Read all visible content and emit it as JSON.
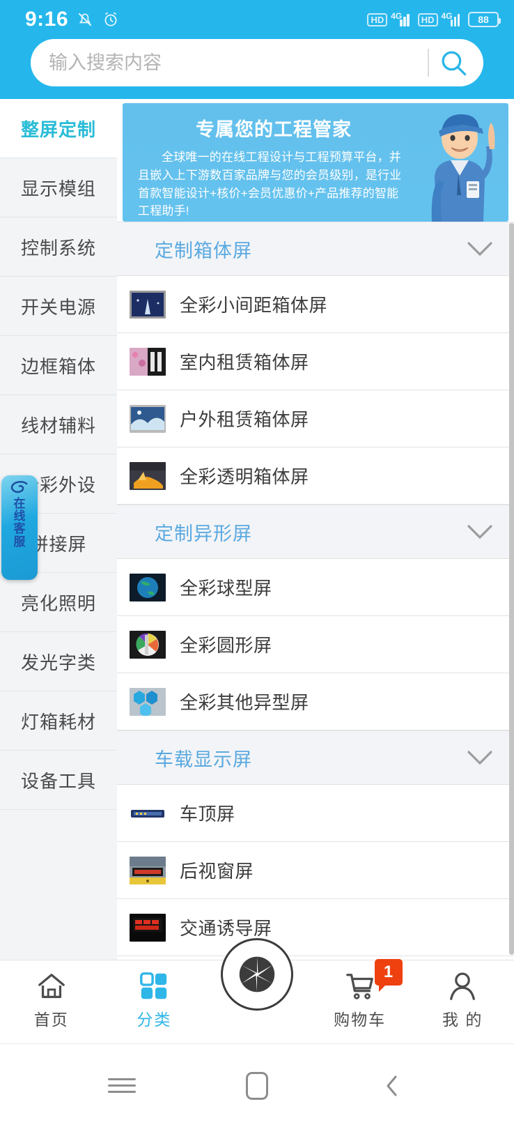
{
  "status_bar": {
    "time": "9:16",
    "mute_icon": "bell-muted-icon",
    "alarm_icon": "alarm-clock-icon",
    "sim1_hd": "HD",
    "sim1_network": "4G",
    "sim2_hd": "HD",
    "sim2_network": "4G",
    "battery_percent": "88"
  },
  "search": {
    "placeholder": "输入搜索内容",
    "value": "",
    "icon": "search-icon"
  },
  "sidebar": {
    "items": [
      {
        "label": "整屏定制",
        "active": true
      },
      {
        "label": "显示模组",
        "active": false
      },
      {
        "label": "控制系统",
        "active": false
      },
      {
        "label": "开关电源",
        "active": false
      },
      {
        "label": "边框箱体",
        "active": false
      },
      {
        "label": "线材辅料",
        "active": false
      },
      {
        "label": "全彩外设",
        "active": false
      },
      {
        "label": "拼接屏",
        "active": false
      },
      {
        "label": "亮化照明",
        "active": false
      },
      {
        "label": "发光字类",
        "active": false
      },
      {
        "label": "灯箱耗材",
        "active": false
      },
      {
        "label": "设备工具",
        "active": false
      }
    ]
  },
  "customer_service": {
    "line1": "在",
    "line2": "线",
    "line3": "客",
    "line4": "服",
    "icon": "swirl-logo-icon"
  },
  "banner": {
    "title": "专属您的工程管家",
    "body": "全球唯一的在线工程设计与工程预算平台，并且嵌入上下游数百家品牌与您的会员级别，是行业首款智能设计+核价+会员优惠价+产品推荐的智能工程助手!",
    "image": "engineer-pointing-illustration"
  },
  "sections": [
    {
      "title": "定制箱体屏",
      "chevron": "chevron-down-icon",
      "products": [
        {
          "name": "全彩小间距箱体屏",
          "thumb": "fine-pitch-screen-thumb"
        },
        {
          "name": "室内租赁箱体屏",
          "thumb": "indoor-rental-screen-thumb"
        },
        {
          "name": "户外租赁箱体屏",
          "thumb": "outdoor-rental-screen-thumb"
        },
        {
          "name": "全彩透明箱体屏",
          "thumb": "transparent-screen-thumb"
        }
      ]
    },
    {
      "title": "定制异形屏",
      "chevron": "chevron-down-icon",
      "products": [
        {
          "name": "全彩球型屏",
          "thumb": "sphere-screen-thumb"
        },
        {
          "name": "全彩圆形屏",
          "thumb": "circular-screen-thumb"
        },
        {
          "name": "全彩其他异型屏",
          "thumb": "hexagon-screen-thumb"
        }
      ]
    },
    {
      "title": "车载显示屏",
      "chevron": "chevron-down-icon",
      "products": [
        {
          "name": "车顶屏",
          "thumb": "taxi-top-screen-thumb"
        },
        {
          "name": "后视窗屏",
          "thumb": "rear-window-screen-thumb"
        },
        {
          "name": "交通诱导屏",
          "thumb": "traffic-guidance-screen-thumb"
        }
      ]
    }
  ],
  "bottom_nav": {
    "items": [
      {
        "label": "首页",
        "icon": "home-icon",
        "active": false
      },
      {
        "label": "分类",
        "icon": "grid-icon",
        "active": true
      },
      {
        "label": "购物车",
        "icon": "cart-icon",
        "active": false,
        "badge": "1"
      },
      {
        "label": "我 的",
        "icon": "user-icon",
        "active": false
      }
    ],
    "center_button": {
      "icon": "camera-shutter-icon"
    }
  },
  "android_nav": {
    "recents": "recents-icon",
    "home": "home-square-icon",
    "back": "back-chevron-icon"
  },
  "colors": {
    "header_blue": "#25b7ec",
    "accent_cyan": "#29bcd6",
    "section_title_blue": "#5aa9e0",
    "badge_red": "#ef4010"
  }
}
